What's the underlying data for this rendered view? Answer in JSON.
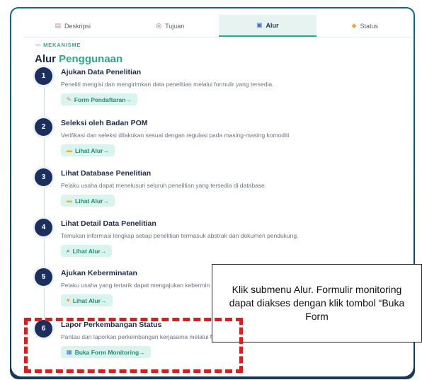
{
  "tabs": [
    {
      "label": "Deskripsi",
      "icon": "document-icon",
      "glyph": "▤",
      "active": false
    },
    {
      "label": "Tujuan",
      "icon": "target-icon",
      "glyph": "◎",
      "active": false
    },
    {
      "label": "Alur",
      "icon": "flow-icon",
      "glyph": "▣",
      "active": true
    },
    {
      "label": "Status",
      "icon": "status-icon",
      "glyph": "◆",
      "active": false
    }
  ],
  "section": {
    "eyebrow": "— MEKANISME",
    "title_main": "Alur",
    "title_accent": "Penggunaan"
  },
  "steps": [
    {
      "number": "1",
      "title": "Ajukan Data Penelitian",
      "description": "Peneliti mengisi dan mengirimkan data penelitian melalui formulir yang tersedia.",
      "button_label": "Form Pendaftaran→",
      "button_icon": "form-icon",
      "button_glyph": "✎"
    },
    {
      "number": "2",
      "title": "Seleksi oleh Badan POM",
      "description": "Verifikasi dan seleksi dilakukan sesuai dengan regulasi pada masing-masing komoditi",
      "button_label": "Lihat Alur→",
      "button_icon": "folder-icon",
      "button_glyph": "▬"
    },
    {
      "number": "3",
      "title": "Lihat Database Penelitian",
      "description": "Pelaku usaha dapat menelusuri seluruh penelitian yang tersedia di database.",
      "button_label": "Lihat Alur→",
      "button_icon": "folder-icon",
      "button_glyph": "▬"
    },
    {
      "number": "4",
      "title": "Lihat Detail Data Penelitian",
      "description": "Temukan informasi lengkap setiap penelitian termasuk abstrak dan dokumen pendukung.",
      "button_label": "Lihat Alur→",
      "button_icon": "magnifier-icon",
      "button_glyph": "⌕"
    },
    {
      "number": "5",
      "title": "Ajukan Keberminatan",
      "description": "Pelaku usaha yang tertarik dapat mengajukan kebermin",
      "button_label": "Lihat Alur→",
      "button_icon": "heart-icon",
      "button_glyph": "♥"
    },
    {
      "number": "6",
      "title": "Lapor Perkembangan Status",
      "description": "Pantau dan laporkan perkembangan kerjasama melalui f",
      "button_label": "Buka Form Monitoring→",
      "button_icon": "chart-icon",
      "button_glyph": "▦"
    }
  ],
  "callout": {
    "text": "Klik submenu Alur. Formulir monitoring dapat diakses dengan klik tombol “Buka Form"
  }
}
